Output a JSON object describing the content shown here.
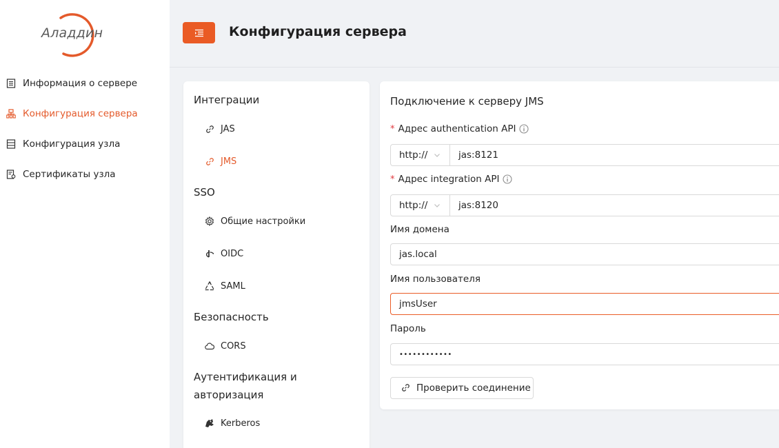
{
  "brand": {
    "logo_text": "Аладдин",
    "accent": "#ea5b25"
  },
  "sidebar": {
    "items": [
      {
        "label": "Информация о сервере",
        "icon": "list-icon",
        "active": false
      },
      {
        "label": "Конфигурация сервера",
        "icon": "hierarchy-icon",
        "active": true
      },
      {
        "label": "Конфигурация узла",
        "icon": "server-icon",
        "active": false
      },
      {
        "label": "Сертификаты узла",
        "icon": "certificate-icon",
        "active": false
      }
    ]
  },
  "header": {
    "menu_icon": "menu-fold-icon",
    "title": "Конфигурация сервера"
  },
  "settings_menu": {
    "groups": [
      {
        "title": "Интеграции",
        "items": [
          {
            "label": "JAS",
            "icon": "link-icon",
            "active": false
          },
          {
            "label": "JMS",
            "icon": "link-icon",
            "active": true
          }
        ]
      },
      {
        "title": "SSO",
        "items": [
          {
            "label": "Общие настройки",
            "icon": "gear-icon",
            "active": false
          },
          {
            "label": "OIDC",
            "icon": "openid-icon",
            "active": false
          },
          {
            "label": "SAML",
            "icon": "saml-icon",
            "active": false
          }
        ]
      },
      {
        "title": "Безопасность",
        "items": [
          {
            "label": "CORS",
            "icon": "cloud-icon",
            "active": false
          }
        ]
      },
      {
        "title_line1": "Аутентификация и",
        "title_line2": "авторизация",
        "items": [
          {
            "label": "Kerberos",
            "icon": "kerberos-icon",
            "active": false
          }
        ]
      }
    ]
  },
  "form": {
    "title": "Подключение к серверу JMS",
    "auth_api": {
      "label": "Адрес authentication API",
      "required": "*",
      "protocol": "http://",
      "value": "jas:8121"
    },
    "integration_api": {
      "label": "Адрес integration API",
      "required": "*",
      "protocol": "http://",
      "value": "jas:8120"
    },
    "domain": {
      "label": "Имя домена",
      "value": "jas.local"
    },
    "username": {
      "label": "Имя пользователя",
      "value": "jmsUser"
    },
    "password": {
      "label": "Пароль",
      "value": "••••••••••••"
    },
    "check_button": "Проверить соединение"
  }
}
